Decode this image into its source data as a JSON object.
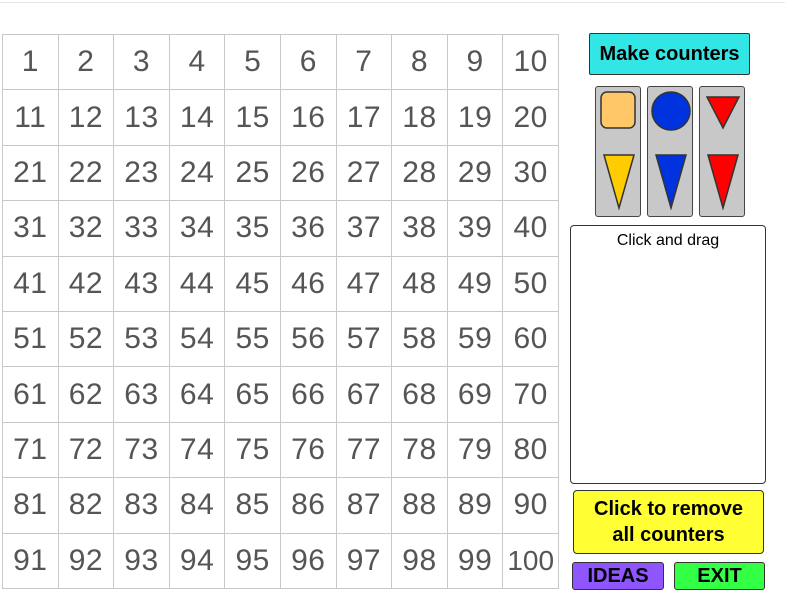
{
  "grid": {
    "numbers": [
      "1",
      "2",
      "3",
      "4",
      "5",
      "6",
      "7",
      "8",
      "9",
      "10",
      "11",
      "12",
      "13",
      "14",
      "15",
      "16",
      "17",
      "18",
      "19",
      "20",
      "21",
      "22",
      "23",
      "24",
      "25",
      "26",
      "27",
      "28",
      "29",
      "30",
      "31",
      "32",
      "33",
      "34",
      "35",
      "36",
      "37",
      "38",
      "39",
      "40",
      "41",
      "42",
      "43",
      "44",
      "45",
      "46",
      "47",
      "48",
      "49",
      "50",
      "51",
      "52",
      "53",
      "54",
      "55",
      "56",
      "57",
      "58",
      "59",
      "60",
      "61",
      "62",
      "63",
      "64",
      "65",
      "66",
      "67",
      "68",
      "69",
      "70",
      "71",
      "72",
      "73",
      "74",
      "75",
      "76",
      "77",
      "78",
      "79",
      "80",
      "81",
      "82",
      "83",
      "84",
      "85",
      "86",
      "87",
      "88",
      "89",
      "90",
      "91",
      "92",
      "93",
      "94",
      "95",
      "96",
      "97",
      "98",
      "99",
      "100"
    ]
  },
  "controls": {
    "make_counters_label": "Make counters",
    "drag_area_label": "Click and drag",
    "remove_line1": "Click to remove",
    "remove_line2": "all counters",
    "ideas_label": "IDEAS",
    "exit_label": "EXIT"
  },
  "counters": [
    {
      "shape": "square",
      "color": "#ffc766"
    },
    {
      "shape": "triangle-down",
      "color": "#ffcc00"
    },
    {
      "shape": "circle",
      "color": "#0033dd"
    },
    {
      "shape": "triangle-down",
      "color": "#0033dd"
    },
    {
      "shape": "triangle-down",
      "color": "#ff0000"
    },
    {
      "shape": "triangle-down",
      "color": "#ff0000"
    }
  ],
  "colors": {
    "make_button": "#33e6e6",
    "remove_button": "#ffff33",
    "ideas_button": "#8f55ff",
    "exit_button": "#33ff44"
  }
}
